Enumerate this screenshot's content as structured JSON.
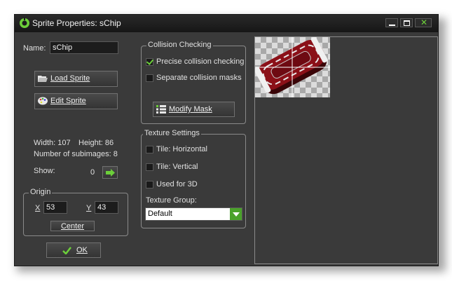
{
  "window": {
    "title": "Sprite Properties: sChip"
  },
  "name": {
    "label": "Name:",
    "value": "sChip"
  },
  "buttons": {
    "load_sprite": "Load Sprite",
    "edit_sprite": "Edit Sprite",
    "modify_mask": "Modify Mask",
    "center": "Center",
    "ok": "OK"
  },
  "info": {
    "width": "Width: 107",
    "height": "Height: 86",
    "subimages": "Number of subimages: 8",
    "show_label": "Show:",
    "show_value": "0"
  },
  "origin": {
    "title": "Origin",
    "x_label": "X",
    "x_value": "53",
    "y_label": "Y",
    "y_value": "43"
  },
  "collision": {
    "title": "Collision Checking",
    "precise_label": "Precise collision checking",
    "precise_checked": true,
    "separate_label": "Separate collision masks",
    "separate_checked": false
  },
  "texture": {
    "title": "Texture Settings",
    "tile_h_label": "Tile: Horizontal",
    "tile_h_checked": false,
    "tile_v_label": "Tile: Vertical",
    "tile_v_checked": false,
    "used3d_label": "Used for 3D",
    "used3d_checked": false,
    "group_label": "Texture Group:",
    "group_value": "Default"
  },
  "colors": {
    "accent": "#4aa22a",
    "chip_red": "#8b1018"
  }
}
